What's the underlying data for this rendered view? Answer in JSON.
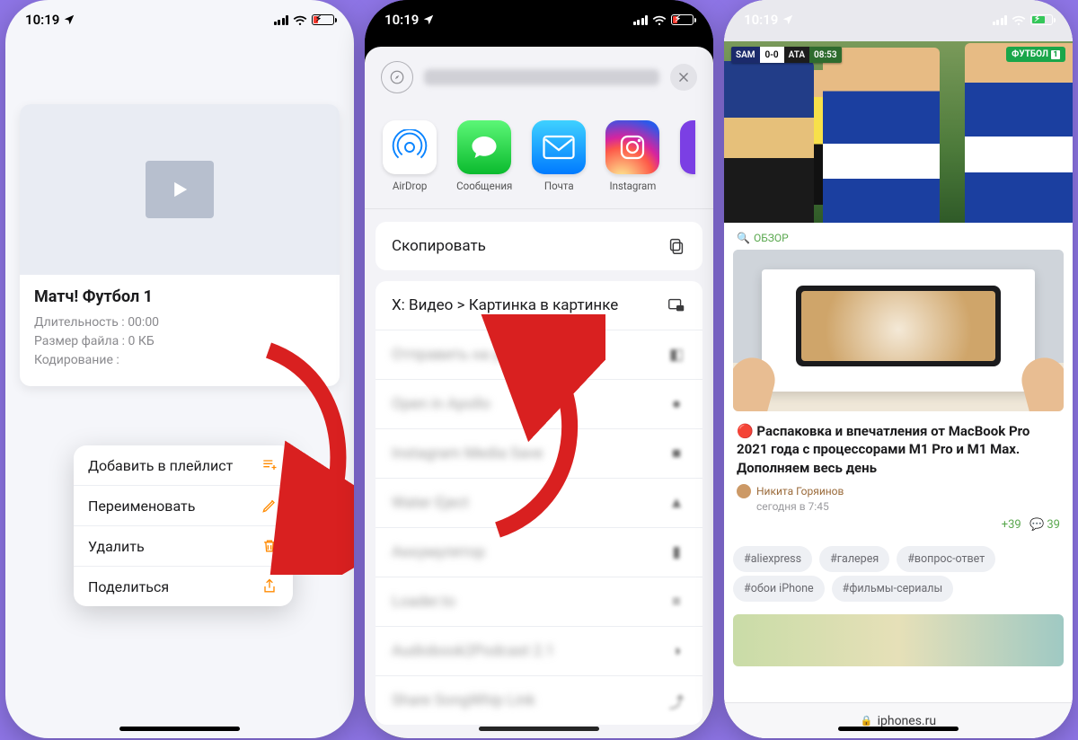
{
  "status": {
    "time": "10:19",
    "battery_low_color": "#ff3b30",
    "battery_ok_color": "#34c759"
  },
  "phone1": {
    "video": {
      "title": "Матч! Футбол 1",
      "duration_label": "Длительность :",
      "duration_value": "00:00",
      "filesize_label": "Размер файла :",
      "filesize_value": "0 КБ",
      "encoding_label": "Кодирование :"
    },
    "context_menu": [
      {
        "label": "Добавить в плейлист",
        "icon": "playlist-add"
      },
      {
        "label": "Переименовать",
        "icon": "pencil"
      },
      {
        "label": "Удалить",
        "icon": "trash"
      },
      {
        "label": "Поделиться",
        "icon": "share"
      }
    ]
  },
  "phone2": {
    "share_apps": [
      {
        "label": "AirDrop",
        "kind": "airdrop"
      },
      {
        "label": "Сообщения",
        "kind": "messages"
      },
      {
        "label": "Почта",
        "kind": "mail"
      },
      {
        "label": "Instagram",
        "kind": "instagram"
      }
    ],
    "actions": {
      "copy": "Скопировать",
      "pip": "X: Видео > Картинка в картинке"
    }
  },
  "phone3": {
    "scorebug": {
      "team1": "SAM",
      "score": "0-0",
      "team2": "ATA",
      "clock": "08:53"
    },
    "channel": "ФУТБОЛ",
    "channel_num": "1",
    "section": "ОБЗОР",
    "article": {
      "title": "Распаковка и впечатления от MacBook Pro 2021 года с процессорами M1 Pro и M1 Max. Дополняем весь день",
      "author": "Никита Горяинов",
      "date": "сегодня в 7:45",
      "plus": "+39",
      "comments": "39"
    },
    "tags": [
      "#aliexpress",
      "#галерея",
      "#вопрос-ответ",
      "#обои iPhone",
      "#фильмы-сериалы"
    ],
    "url": "iphones.ru"
  }
}
